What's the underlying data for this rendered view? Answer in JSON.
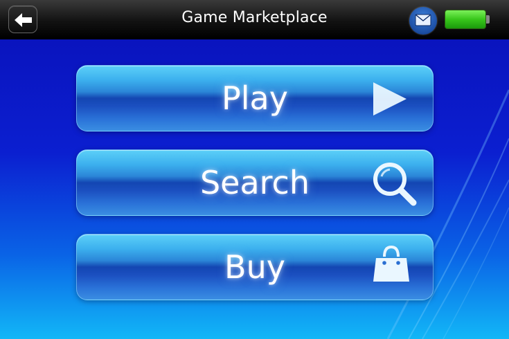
{
  "header": {
    "title": "Game Marketplace",
    "back_icon": "back-arrow-icon",
    "mail_icon": "mail-icon",
    "battery_level": 1.0,
    "battery_color": "#38c61b"
  },
  "menu": {
    "items": [
      {
        "label": "Play",
        "icon": "play-icon"
      },
      {
        "label": "Search",
        "icon": "magnifier-icon"
      },
      {
        "label": "Buy",
        "icon": "shopping-bag-icon"
      }
    ]
  },
  "colors": {
    "accent": "#3cb0ee",
    "background_top": "#0a10b8",
    "background_bottom": "#12b7f7"
  }
}
